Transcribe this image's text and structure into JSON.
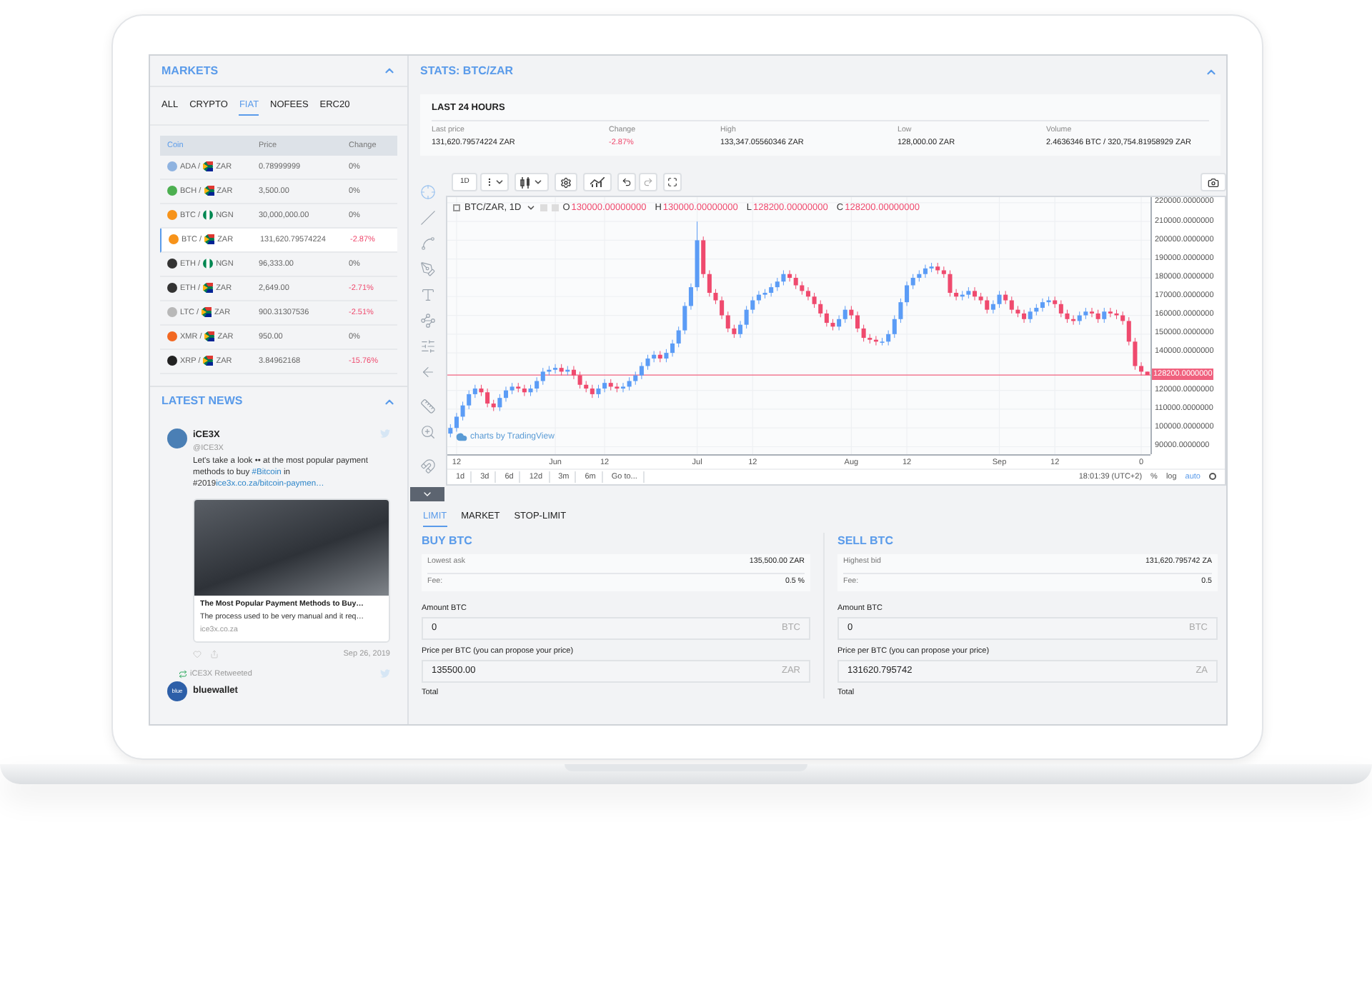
{
  "markets": {
    "title": "MARKETS",
    "tabs": [
      {
        "label": "ALL",
        "selected": false
      },
      {
        "label": "CRYPTO",
        "selected": false
      },
      {
        "label": "FIAT",
        "selected": true
      },
      {
        "label": "NOFEES",
        "selected": false
      },
      {
        "label": "ERC20",
        "selected": false
      }
    ],
    "columns": [
      "Coin",
      "Price",
      "Change"
    ],
    "rows": [
      {
        "base": "ADA /",
        "quote": "ZAR",
        "kind": "za",
        "color": "#8fb3e0",
        "price": "0.78999999",
        "change": "0%",
        "negative": false,
        "selected": false
      },
      {
        "base": "BCH /",
        "quote": "ZAR",
        "kind": "za",
        "color": "#4caf50",
        "price": "3,500.00",
        "change": "0%",
        "negative": false,
        "selected": false
      },
      {
        "base": "BTC /",
        "quote": "NGN",
        "kind": "ng",
        "color": "#f7931a",
        "price": "30,000,000.00",
        "change": "0%",
        "negative": false,
        "selected": false
      },
      {
        "base": "BTC /",
        "quote": "ZAR",
        "kind": "za",
        "color": "#f7931a",
        "price": "131,620.79574224",
        "change": "-2.87%",
        "negative": true,
        "selected": true
      },
      {
        "base": "ETH /",
        "quote": "NGN",
        "kind": "ng",
        "color": "#333333",
        "price": "96,333.00",
        "change": "0%",
        "negative": false,
        "selected": false
      },
      {
        "base": "ETH /",
        "quote": "ZAR",
        "kind": "za",
        "color": "#333333",
        "price": "2,649.00",
        "change": "-2.71%",
        "negative": true,
        "selected": false
      },
      {
        "base": "LTC /",
        "quote": "ZAR",
        "kind": "za",
        "color": "#b8b8b8",
        "price": "900.31307536",
        "change": "-2.51%",
        "negative": true,
        "selected": false
      },
      {
        "base": "XMR /",
        "quote": "ZAR",
        "kind": "za",
        "color": "#f26822",
        "price": "950.00",
        "change": "0%",
        "negative": false,
        "selected": false
      },
      {
        "base": "XRP /",
        "quote": "ZAR",
        "kind": "za",
        "color": "#222222",
        "price": "3.84962168",
        "change": "-15.76%",
        "negative": true,
        "selected": false
      }
    ]
  },
  "news": {
    "title": "LATEST NEWS",
    "tweet": {
      "author": "iCE3X",
      "handle": "@ICE3X",
      "text": [
        {
          "text": "Let's take a look •• at the most popular payment methods to buy ",
          "link": false
        },
        {
          "text": "#Bitcoin",
          "link": true
        },
        {
          "text": " in #2019",
          "link": false
        },
        {
          "text": "ice3x.co.za/bitcoin-paymen…",
          "link": true
        }
      ],
      "card": {
        "title": "The Most Popular Payment Methods to Buy…",
        "description": "The process used to be very manual and it req…",
        "domain": "ice3x.co.za"
      },
      "date": "Sep 26, 2019"
    },
    "retweet": {
      "retweeted_by": "iCE3X Retweeted",
      "avatar_label": "blue",
      "author": "bluewallet"
    }
  },
  "stats": {
    "title": "STATS: BTC/ZAR",
    "period": "LAST 24 HOURS",
    "items": [
      {
        "label": "Last price",
        "value": "131,620.79574224 ZAR",
        "negative": false
      },
      {
        "label": "Change",
        "value": "-2.87%",
        "negative": true
      },
      {
        "label": "High",
        "value": "133,347.05560346 ZAR",
        "negative": false
      },
      {
        "label": "Low",
        "value": "128,000.00 ZAR",
        "negative": false
      },
      {
        "label": "Volume",
        "value": "2.4636346 BTC / 320,754.81958929 ZAR",
        "negative": false
      }
    ]
  },
  "chart": {
    "interval": "1D",
    "symbol": "BTC/ZAR, 1D",
    "ohlc": [
      {
        "key": "O",
        "value": "130000.00000000"
      },
      {
        "key": "H",
        "value": "130000.00000000"
      },
      {
        "key": "L",
        "value": "128200.00000000"
      },
      {
        "key": "C",
        "value": "128200.00000000"
      }
    ],
    "watermark": "charts by TradingView",
    "ranges": [
      "1d",
      "3d",
      "6d",
      "12d",
      "3m",
      "6m",
      "Go to..."
    ],
    "time": "18:01:39 (UTC+2)",
    "scale_options": [
      {
        "label": "%",
        "selected": false
      },
      {
        "label": "log",
        "selected": false
      },
      {
        "label": "auto",
        "selected": true
      }
    ],
    "chart_data": {
      "type": "candlestick",
      "categories": [
        null,
        "12",
        null,
        null,
        null,
        null,
        null,
        null,
        null,
        null,
        null,
        null,
        null,
        null,
        null,
        null,
        null,
        "Jun",
        null,
        null,
        null,
        null,
        null,
        null,
        null,
        "12",
        null,
        null,
        null,
        null,
        null,
        null,
        null,
        null,
        null,
        null,
        null,
        null,
        null,
        null,
        "Jul",
        null,
        null,
        null,
        null,
        null,
        null,
        null,
        null,
        "12",
        null,
        null,
        null,
        null,
        null,
        null,
        null,
        null,
        null,
        null,
        null,
        null,
        null,
        null,
        null,
        "Aug",
        null,
        null,
        null,
        null,
        null,
        null,
        null,
        null,
        "12",
        null,
        null,
        null,
        null,
        null,
        null,
        null,
        null,
        null,
        null,
        null,
        null,
        null,
        null,
        "Sep",
        null,
        null,
        null,
        null,
        null,
        null,
        null,
        null,
        "12",
        null,
        null,
        null,
        null,
        null,
        null,
        null,
        null,
        null,
        null,
        null,
        null,
        null,
        "0",
        null
      ],
      "ohlc": [
        [
          97000,
          102000,
          95000,
          100000
        ],
        [
          100000,
          108000,
          98000,
          106000
        ],
        [
          106000,
          114000,
          104000,
          112000
        ],
        [
          112000,
          120000,
          110000,
          118000
        ],
        [
          118000,
          123000,
          116000,
          121000
        ],
        [
          121000,
          123000,
          117000,
          119000
        ],
        [
          119000,
          121000,
          111000,
          113000
        ],
        [
          113000,
          115000,
          109000,
          111000
        ],
        [
          111000,
          118000,
          109000,
          116000
        ],
        [
          116000,
          122000,
          114000,
          120000
        ],
        [
          120000,
          124000,
          118000,
          122000
        ],
        [
          122000,
          124000,
          119000,
          121000
        ],
        [
          121000,
          123000,
          117000,
          119000
        ],
        [
          119000,
          123000,
          117000,
          121000
        ],
        [
          121000,
          127000,
          119000,
          125000
        ],
        [
          125000,
          132000,
          123000,
          130000
        ],
        [
          130000,
          133000,
          128000,
          131000
        ],
        [
          131000,
          134000,
          129000,
          132000
        ],
        [
          132000,
          134000,
          128000,
          130000
        ],
        [
          130000,
          133000,
          128000,
          131000
        ],
        [
          131000,
          133000,
          126000,
          128000
        ],
        [
          128000,
          130000,
          121000,
          123000
        ],
        [
          123000,
          125000,
          119000,
          121000
        ],
        [
          121000,
          123000,
          116000,
          118000
        ],
        [
          118000,
          123000,
          116000,
          121000
        ],
        [
          121000,
          126000,
          119000,
          124000
        ],
        [
          124000,
          126000,
          120000,
          122000
        ],
        [
          122000,
          124000,
          119000,
          121000
        ],
        [
          121000,
          124000,
          119000,
          122000
        ],
        [
          122000,
          127000,
          120000,
          125000
        ],
        [
          125000,
          130000,
          123000,
          128000
        ],
        [
          128000,
          135000,
          126000,
          133000
        ],
        [
          133000,
          139000,
          131000,
          137000
        ],
        [
          137000,
          141000,
          135000,
          139000
        ],
        [
          139000,
          141000,
          135000,
          137000
        ],
        [
          137000,
          142000,
          135000,
          140000
        ],
        [
          140000,
          147000,
          138000,
          145000
        ],
        [
          145000,
          154000,
          143000,
          152000
        ],
        [
          152000,
          167000,
          150000,
          165000
        ],
        [
          165000,
          177000,
          163000,
          175000
        ],
        [
          175000,
          210000,
          173000,
          200000
        ],
        [
          200000,
          202000,
          180000,
          182000
        ],
        [
          182000,
          184000,
          170000,
          172000
        ],
        [
          172000,
          174000,
          166000,
          168000
        ],
        [
          168000,
          170000,
          158000,
          160000
        ],
        [
          160000,
          162000,
          151000,
          153000
        ],
        [
          153000,
          155000,
          148000,
          150000
        ],
        [
          150000,
          157000,
          148000,
          155000
        ],
        [
          155000,
          165000,
          153000,
          163000
        ],
        [
          163000,
          170000,
          161000,
          168000
        ],
        [
          168000,
          173000,
          166000,
          171000
        ],
        [
          171000,
          174000,
          169000,
          172000
        ],
        [
          172000,
          177000,
          170000,
          175000
        ],
        [
          175000,
          180000,
          173000,
          178000
        ],
        [
          178000,
          184000,
          176000,
          182000
        ],
        [
          182000,
          184000,
          178000,
          180000
        ],
        [
          180000,
          182000,
          174000,
          176000
        ],
        [
          176000,
          178000,
          171000,
          173000
        ],
        [
          173000,
          175000,
          168000,
          170000
        ],
        [
          170000,
          172000,
          164000,
          166000
        ],
        [
          166000,
          168000,
          159000,
          161000
        ],
        [
          161000,
          163000,
          154000,
          156000
        ],
        [
          156000,
          158000,
          152000,
          154000
        ],
        [
          154000,
          160000,
          152000,
          158000
        ],
        [
          158000,
          165000,
          156000,
          163000
        ],
        [
          163000,
          165000,
          158000,
          160000
        ],
        [
          160000,
          162000,
          151000,
          153000
        ],
        [
          153000,
          155000,
          146000,
          148000
        ],
        [
          148000,
          150000,
          145000,
          147000
        ],
        [
          147000,
          149000,
          144000,
          146000
        ],
        [
          146000,
          148000,
          144000,
          146000
        ],
        [
          146000,
          152000,
          144000,
          150000
        ],
        [
          150000,
          160000,
          148000,
          158000
        ],
        [
          158000,
          169000,
          156000,
          167000
        ],
        [
          167000,
          178000,
          165000,
          176000
        ],
        [
          176000,
          182000,
          174000,
          180000
        ],
        [
          180000,
          184000,
          178000,
          182000
        ],
        [
          182000,
          187000,
          180000,
          185000
        ],
        [
          185000,
          188000,
          183000,
          186000
        ],
        [
          186000,
          188000,
          182000,
          184000
        ],
        [
          184000,
          186000,
          180000,
          182000
        ],
        [
          182000,
          184000,
          170000,
          172000
        ],
        [
          172000,
          174000,
          168000,
          170000
        ],
        [
          170000,
          173000,
          168000,
          171000
        ],
        [
          171000,
          175000,
          169000,
          173000
        ],
        [
          173000,
          175000,
          168000,
          170000
        ],
        [
          170000,
          172000,
          166000,
          168000
        ],
        [
          168000,
          170000,
          161000,
          163000
        ],
        [
          163000,
          168000,
          161000,
          166000
        ],
        [
          166000,
          173000,
          164000,
          171000
        ],
        [
          171000,
          173000,
          166000,
          168000
        ],
        [
          168000,
          170000,
          161000,
          163000
        ],
        [
          163000,
          165000,
          159000,
          161000
        ],
        [
          161000,
          163000,
          156000,
          158000
        ],
        [
          158000,
          164000,
          156000,
          162000
        ],
        [
          162000,
          166000,
          160000,
          164000
        ],
        [
          164000,
          169000,
          162000,
          167000
        ],
        [
          167000,
          170000,
          165000,
          168000
        ],
        [
          168000,
          170000,
          164000,
          166000
        ],
        [
          166000,
          168000,
          159000,
          161000
        ],
        [
          161000,
          163000,
          156000,
          158000
        ],
        [
          158000,
          160000,
          155000,
          157000
        ],
        [
          157000,
          162000,
          155000,
          160000
        ],
        [
          160000,
          164000,
          158000,
          162000
        ],
        [
          162000,
          164000,
          159000,
          161000
        ],
        [
          161000,
          163000,
          156000,
          158000
        ],
        [
          158000,
          164000,
          156000,
          162000
        ],
        [
          162000,
          164000,
          159000,
          161000
        ],
        [
          161000,
          163000,
          158000,
          160000
        ],
        [
          160000,
          162000,
          155000,
          157000
        ],
        [
          157000,
          159000,
          144000,
          146000
        ],
        [
          146000,
          148000,
          131000,
          133000
        ],
        [
          133000,
          135000,
          128000,
          130000
        ],
        [
          130000,
          130000,
          128200,
          128200
        ]
      ],
      "ylim": [
        86000,
        223000
      ],
      "yticks": [
        {
          "value": 220000,
          "label": "220000.0000000"
        },
        {
          "value": 210000,
          "label": "210000.0000000"
        },
        {
          "value": 200000,
          "label": "200000.0000000"
        },
        {
          "value": 190000,
          "label": "190000.0000000"
        },
        {
          "value": 180000,
          "label": "180000.0000000"
        },
        {
          "value": 170000,
          "label": "170000.0000000"
        },
        {
          "value": 160000,
          "label": "160000.0000000"
        },
        {
          "value": 150000,
          "label": "150000.0000000"
        },
        {
          "value": 140000,
          "label": "140000.0000000"
        },
        {
          "value": 120000,
          "label": "120000.0000000"
        },
        {
          "value": 110000,
          "label": "110000.0000000"
        },
        {
          "value": 100000,
          "label": "100000.0000000"
        },
        {
          "value": 90000,
          "label": "90000.0000000"
        }
      ],
      "grid": true,
      "ref_lines": [
        {
          "axis": "y",
          "value": 128200,
          "color": "#f0617e",
          "label": "128200.0000000"
        }
      ]
    }
  },
  "order": {
    "tabs": [
      {
        "label": "LIMIT",
        "selected": true
      },
      {
        "label": "MARKET",
        "selected": false
      },
      {
        "label": "STOP-LIMIT",
        "selected": false
      }
    ],
    "panels": [
      {
        "title": "BUY BTC",
        "info": [
          {
            "label": "Lowest ask",
            "value": "135,500.00 ZAR"
          },
          {
            "label": "Fee:",
            "value": "0.5 %"
          }
        ],
        "fields": [
          {
            "label": "Amount BTC",
            "value": "0",
            "unit": "BTC"
          },
          {
            "label": "Price per BTC (you can propose your price)",
            "value": "135500.00",
            "unit": "ZAR"
          }
        ],
        "total_label": "Total"
      },
      {
        "title": "SELL BTC",
        "info": [
          {
            "label": "Highest bid",
            "value": "131,620.795742 ZA"
          },
          {
            "label": "Fee:",
            "value": "0.5"
          }
        ],
        "fields": [
          {
            "label": "Amount BTC",
            "value": "0",
            "unit": "BTC"
          },
          {
            "label": "Price per BTC (you can propose your price)",
            "value": "131620.795742",
            "unit": "ZA"
          }
        ],
        "total_label": "Total"
      }
    ]
  }
}
